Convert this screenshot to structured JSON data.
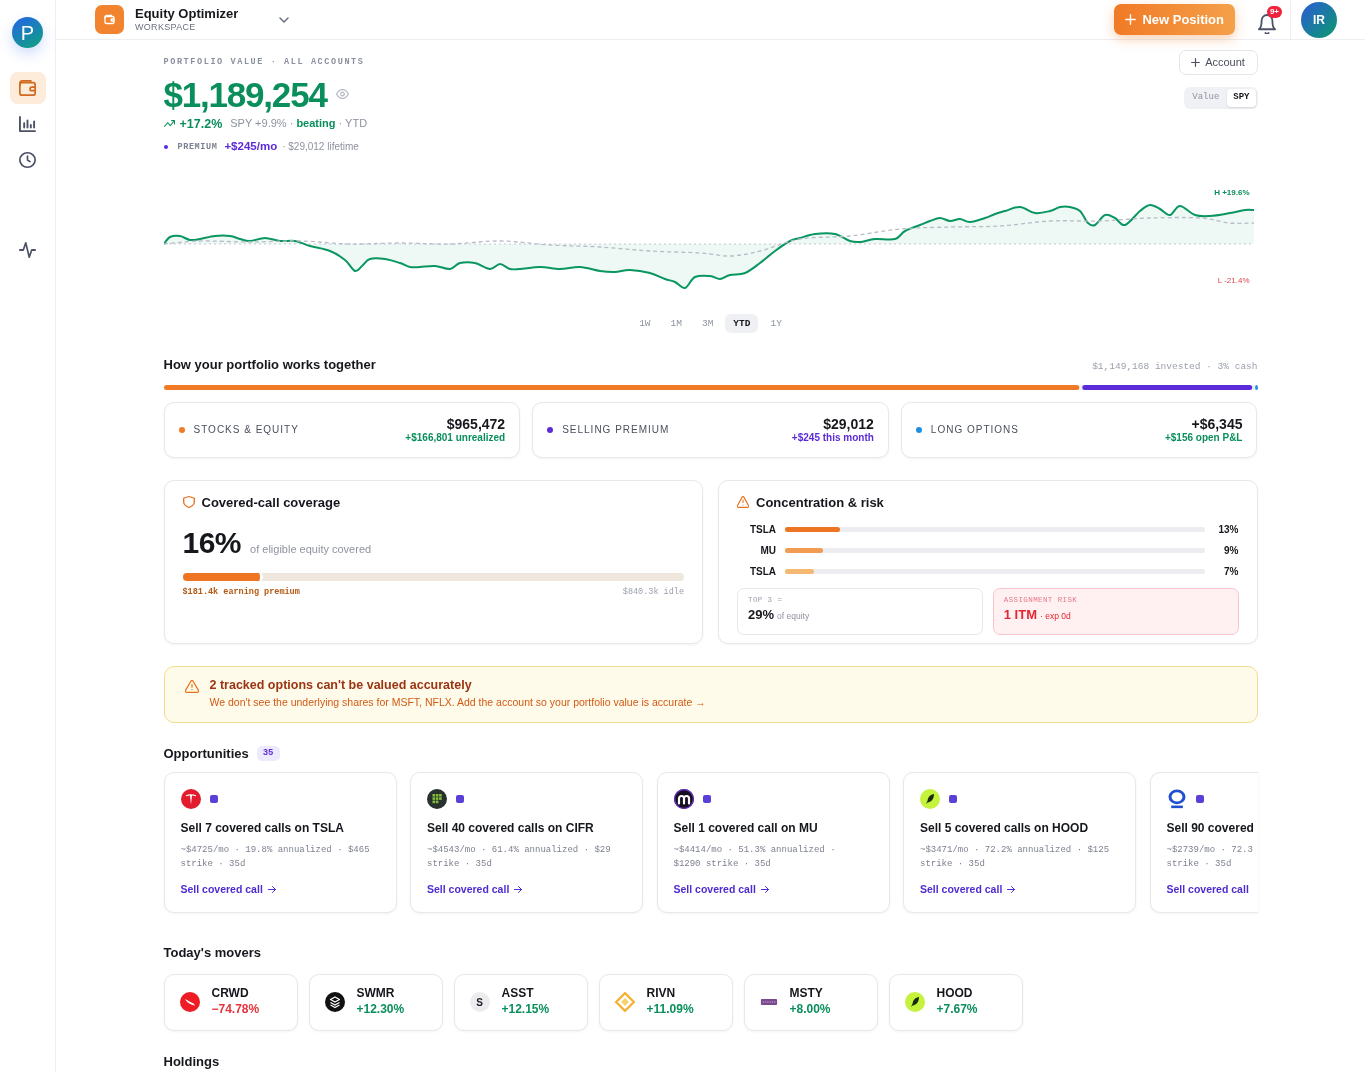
{
  "sidebar": {
    "logo_text": "P",
    "items": [
      {
        "selected": true
      },
      {
        "selected": false
      },
      {
        "selected": false
      }
    ],
    "secondary_items": [
      {
        "selected": false
      }
    ]
  },
  "header": {
    "workspace_name": "Equity Optimizer",
    "workspace_label": "WORKSPACE",
    "new_position_button": "New Position",
    "notification_badge": "9+",
    "avatar_initials": "IR"
  },
  "portfolio": {
    "eyebrow": "PORTFOLIO VALUE · ALL ACCOUNTS",
    "value": "$1,189,254",
    "change": "+17.2%",
    "comparison": "SPY +9.9% · **beating** · YTD",
    "premium_label": "PREMIUM",
    "premium_value": "+$245/mo",
    "premium_lifetime": "· $29,012 lifetime",
    "account_button": "Account",
    "compare_toggle": [
      {
        "label": "Value",
        "selected": false
      },
      {
        "label": "SPY",
        "selected": true
      }
    ]
  },
  "chart": {
    "high_label": "H +19.6%",
    "low_label": "L -21.4%",
    "ranges": [
      {
        "label": "1W",
        "selected": false
      },
      {
        "label": "1M",
        "selected": false
      },
      {
        "label": "3M",
        "selected": false
      },
      {
        "label": "YTD",
        "selected": true
      },
      {
        "label": "1Y",
        "selected": false
      }
    ]
  },
  "allocation": {
    "title": "How your portfolio works together",
    "summary": "$1,149,168 invested · 3% cash",
    "segments": [
      {
        "level": 0.838,
        "color": "#f07a26"
      },
      {
        "level": 0.158,
        "color": "#5b2bd9"
      },
      {
        "level": 0.004,
        "color": "#1d8fe1"
      }
    ],
    "cards": [
      {
        "label": "STOCKS & EQUITY",
        "color": "#f07a26",
        "value": "$965,472",
        "detail": "+$166,801 unrealized",
        "kind": "gain"
      },
      {
        "label": "SELLING PREMIUM",
        "color": "#5b2bd9",
        "value": "$29,012",
        "detail": "+$245 this month",
        "kind": "premium"
      },
      {
        "label": "LONG OPTIONS",
        "color": "#1d8fe1",
        "value": "+$6,345",
        "detail": "+$156 open P&L",
        "kind": "gain"
      }
    ]
  },
  "coverage": {
    "title": "Covered-call coverage",
    "percent": "16%",
    "caption": "of eligible equity covered",
    "level": 0.16,
    "covered_label": "$181.4k earning premium",
    "idle_label": "$840.3k idle"
  },
  "concentration": {
    "title": "Concentration & risk",
    "rows": [
      {
        "ticker": "TSLA",
        "level": 0.13,
        "percent": "13%",
        "color": "#ee7424"
      },
      {
        "ticker": "MU",
        "level": 0.09,
        "percent": "9%",
        "color": "#f29b52"
      },
      {
        "ticker": "TSLA",
        "level": 0.07,
        "percent": "7%",
        "color": "#f5b870"
      }
    ],
    "top_label": "TOP 3 =",
    "top_value": "29%",
    "top_caption": "of equity",
    "risk_label": "ASSIGNMENT RISK",
    "risk_value": "1 ITM",
    "risk_caption": "· exp 0d"
  },
  "alert": {
    "title": "2 tracked options can't be valued accurately",
    "message": "We don't see the underlying shares for MSFT, NFLX. Add the account so your portfolio value is accurate →"
  },
  "opportunities": {
    "title": "Opportunities",
    "count": "35",
    "items": [
      {
        "title": "Sell 7 covered calls on TSLA",
        "details": [
          "~$4725/mo · 19.8% annualized · $465",
          "strike · 35d"
        ],
        "action": "Sell covered call",
        "cut_off": false
      },
      {
        "title": "Sell 40 covered calls on CIFR",
        "details": [
          "~$4543/mo · 61.4% annualized · $29",
          "strike · 35d"
        ],
        "action": "Sell covered call",
        "cut_off": false
      },
      {
        "title": "Sell 1 covered call on MU",
        "details": [
          "~$4414/mo · 51.3% annualized ·",
          "$1290 strike · 35d"
        ],
        "action": "Sell covered call",
        "cut_off": false
      },
      {
        "title": "Sell 5 covered calls on HOOD",
        "details": [
          "~$3471/mo · 72.2% annualized · $125",
          "strike · 35d"
        ],
        "action": "Sell covered call",
        "cut_off": false
      },
      {
        "title": "Sell 90 covered",
        "details": [
          "~$2739/mo · 72.3",
          "strike · 35d"
        ],
        "action": "Sell covered call",
        "cut_off": true
      }
    ]
  },
  "movers": {
    "title": "Today's movers",
    "items": [
      {
        "ticker": "CRWD",
        "change": "−74.78%",
        "negative": true
      },
      {
        "ticker": "SWMR",
        "change": "+12.30%",
        "negative": false
      },
      {
        "ticker": "ASST",
        "logo_text": "S",
        "change": "+12.15%",
        "negative": false
      },
      {
        "ticker": "RIVN",
        "change": "+11.09%",
        "negative": false
      },
      {
        "ticker": "MSTY",
        "change": "+8.00%",
        "negative": false
      },
      {
        "ticker": "HOOD",
        "change": "+7.67%",
        "negative": false
      }
    ]
  },
  "holdings": {
    "title": "Holdings"
  }
}
